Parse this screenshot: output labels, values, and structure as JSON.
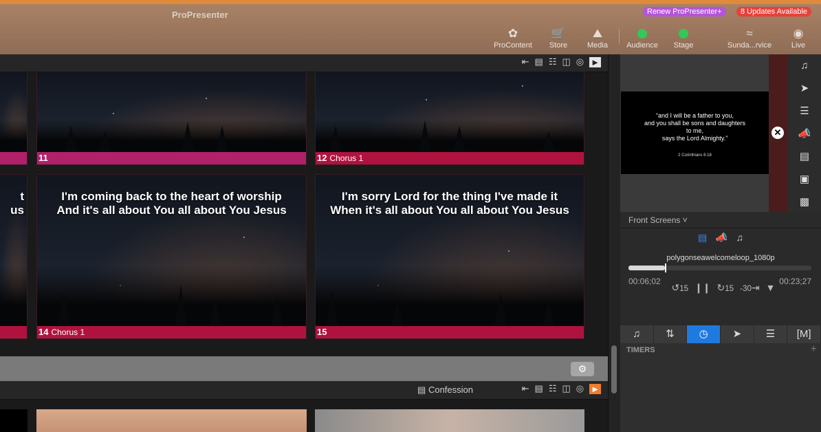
{
  "app": {
    "title": "ProPresenter",
    "renew_label": "Renew ProPresenter+",
    "updates_label": "8 Updates Available"
  },
  "toolbar": [
    {
      "label": "ProContent",
      "icon": "procontent-icon"
    },
    {
      "label": "Store",
      "icon": "cart-icon"
    },
    {
      "label": "Media",
      "icon": "media-icon"
    },
    {
      "label": "Audience",
      "icon": "status-dot"
    },
    {
      "label": "Stage",
      "icon": "status-dot"
    },
    {
      "label": "Sunda...rvice",
      "icon": "mustache-icon"
    },
    {
      "label": "Live",
      "icon": "broadcast-icon"
    }
  ],
  "slides": [
    {
      "number": "11",
      "label": "",
      "lyric": "",
      "color": "#b0216a"
    },
    {
      "number": "12",
      "label": "Chorus 1",
      "lyric": "",
      "color": "#b0123f"
    },
    {
      "number": "14",
      "label": "Chorus 1",
      "lyric": "I'm coming back to the heart of worship\nAnd it's all about You all about You Jesus",
      "color": "#b0123f"
    },
    {
      "number": "15",
      "label": "",
      "lyric": "I'm sorry Lord for the thing I've made it\nWhen it's all about You all about You Jesus",
      "color": "#b0123f"
    },
    {
      "partial_lyric": "t\nus"
    }
  ],
  "presentation": {
    "title": "Confession"
  },
  "preview": {
    "text": "“and I will be a father to you,\nand you shall be sons and daughters\nto me,\nsays the Lord Almighty.”",
    "reference": "2 Corinthians 6:18"
  },
  "screens": {
    "label": "Front Screens ˅"
  },
  "media": {
    "name": "polygonseawelcomeloop_1080p",
    "elapsed": "00:06;02",
    "remaining": "00:23;27",
    "progress": 0.2,
    "skip_back": "15",
    "skip_fwd": "15",
    "jump": "-30"
  },
  "timers": {
    "header": "TIMERS",
    "add": "+"
  },
  "colors": {
    "accent": "#1f7ae0",
    "live_green": "#34c759",
    "orange": "#ef7d2f"
  }
}
